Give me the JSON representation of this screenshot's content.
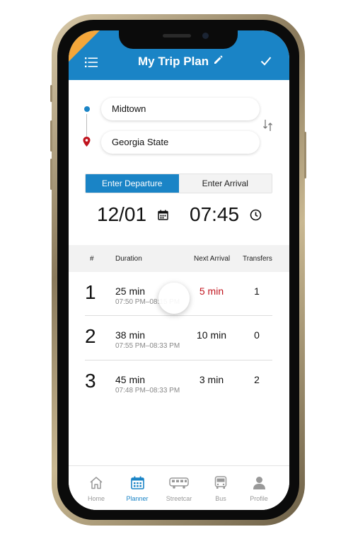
{
  "header": {
    "title": "My Trip Plan"
  },
  "route": {
    "from": "Midtown",
    "to": "Georgia State"
  },
  "mode": {
    "departure_label": "Enter Departure",
    "arrival_label": "Enter Arrival",
    "selected": "departure"
  },
  "datetime": {
    "date": "12/01",
    "time": "07:45"
  },
  "table": {
    "headers": {
      "num": "#",
      "duration": "Duration",
      "next_arrival": "Next Arrival",
      "transfers": "Transfers"
    },
    "rows": [
      {
        "num": "1",
        "duration": "25 min",
        "times": "07:50 PM–08:15 PM",
        "next_arrival": "5 min",
        "transfers": "1",
        "next_arrival_color": "#c0141e"
      },
      {
        "num": "2",
        "duration": "38 min",
        "times": "07:55 PM–08:33 PM",
        "next_arrival": "10 min",
        "transfers": "0"
      },
      {
        "num": "3",
        "duration": "45 min",
        "times": "07:48 PM–08:33 PM",
        "next_arrival": "3 min",
        "transfers": "2"
      }
    ]
  },
  "nav": {
    "items": [
      {
        "label": "Home",
        "icon": "home-icon"
      },
      {
        "label": "Planner",
        "icon": "calendar-icon",
        "active": true
      },
      {
        "label": "Streetcar",
        "icon": "streetcar-icon"
      },
      {
        "label": "Bus",
        "icon": "bus-icon"
      },
      {
        "label": "Profile",
        "icon": "profile-icon"
      }
    ]
  },
  "colors": {
    "primary": "#1a84c6",
    "accent_corner": "#f4a63a",
    "alert": "#c0141e"
  }
}
